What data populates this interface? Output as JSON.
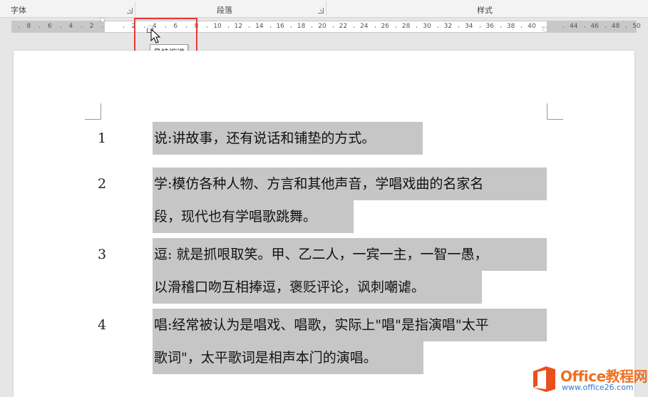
{
  "ribbon": {
    "groups": [
      {
        "label": "字体"
      },
      {
        "label": "段落"
      },
      {
        "label": "样式"
      }
    ]
  },
  "ruler": {
    "left_labels": [
      "8",
      "6",
      "4",
      "2"
    ],
    "right_labels": [
      "2",
      "4",
      "6",
      "8",
      "10",
      "12",
      "14",
      "16",
      "18",
      "20",
      "22",
      "24",
      "26",
      "28",
      "30",
      "32",
      "34",
      "36",
      "38",
      "40"
    ],
    "far_labels": [
      "44",
      "46",
      "48",
      "50"
    ]
  },
  "tooltip": {
    "text": "悬挂缩进"
  },
  "document": {
    "paragraphs": [
      {
        "number": "1",
        "lines": [
          "说:讲故事，还有说话和铺垫的方式。"
        ]
      },
      {
        "number": "2",
        "lines": [
          "学:模仿各种人物、方言和其他声音，学唱戏曲的名家名",
          "段，现代也有学唱歌跳舞。"
        ]
      },
      {
        "number": "3",
        "lines": [
          "逗: 就是抓哏取笑。甲、乙二人，一宾一主，一智一愚，",
          "以滑稽口吻互相捧逗，褒贬评论，讽刺嘲谑。"
        ]
      },
      {
        "number": "4",
        "lines": [
          "唱:经常被认为是唱戏、唱歌，实际上\"唱\"是指演唱\"太平",
          "歌词\"，太平歌词是相声本门的演唱。"
        ]
      }
    ]
  },
  "watermark": {
    "brand": "Office教程网",
    "url": "www.office26.com",
    "colors": {
      "brand": "#f07020",
      "url": "#2b7cd3",
      "logo": "#e8501c"
    }
  },
  "colors": {
    "highlight": "#c6c6c6",
    "callout": "#e53935"
  }
}
